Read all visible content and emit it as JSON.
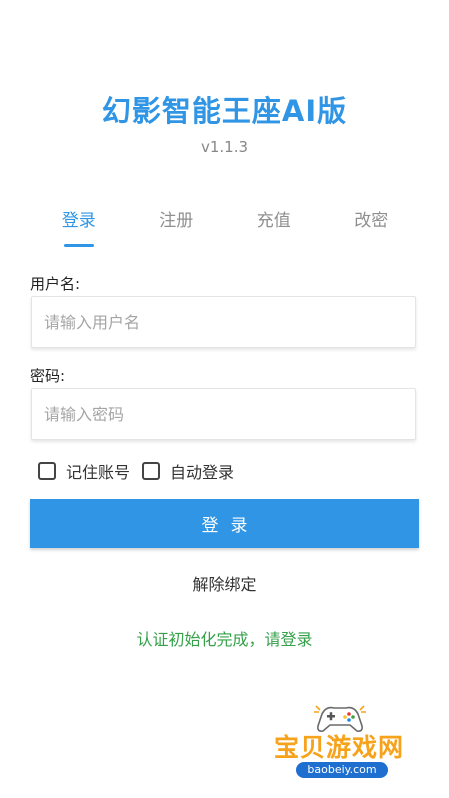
{
  "app": {
    "title": "幻影智能王座AI版",
    "version": "v1.1.3",
    "accent_color": "#2f95e4"
  },
  "tabs": [
    {
      "label": "登录",
      "active": true
    },
    {
      "label": "注册",
      "active": false
    },
    {
      "label": "充值",
      "active": false
    },
    {
      "label": "改密",
      "active": false
    }
  ],
  "form": {
    "username_label": "用户名:",
    "username_placeholder": "请输入用户名",
    "username_value": "",
    "password_label": "密码:",
    "password_placeholder": "请输入密码",
    "password_value": "",
    "remember_label": "记住账号",
    "remember_checked": false,
    "autologin_label": "自动登录",
    "autologin_checked": false,
    "login_button": "登录"
  },
  "links": {
    "unbind": "解除绑定"
  },
  "status": {
    "message": "认证初始化完成，请登录",
    "color": "#35a14a"
  },
  "watermark": {
    "brand": "宝贝游戏网",
    "url": "baobeiy.com",
    "icon": "gamepad-icon"
  }
}
